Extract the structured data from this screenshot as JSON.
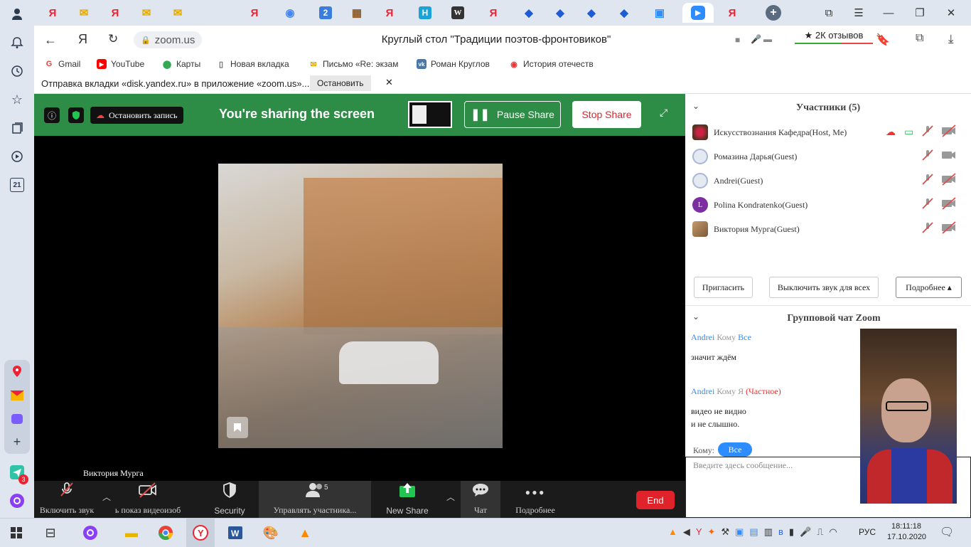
{
  "browser": {
    "url": "zoom.us",
    "page_title": "Круглый стол \"Традиции поэтов-фронтовиков\"",
    "reviews": "★ 2К отзывов",
    "yandex_letter": "Я",
    "notification": "Отправка вкладки «disk.yandex.ru» в приложение «zoom.us»...",
    "notification_stop": "Остановить",
    "bookmarks": [
      {
        "label": "Gmail",
        "icon": "gmail-icon"
      },
      {
        "label": "YouTube",
        "icon": "youtube-icon"
      },
      {
        "label": "Карты",
        "icon": "maps-icon"
      },
      {
        "label": "Новая вкладка",
        "icon": "page-icon"
      },
      {
        "label": "Письмо «Re: экзам",
        "icon": "mail-icon"
      },
      {
        "label": "Роман Круглов",
        "icon": "vk-icon"
      },
      {
        "label": "История отечеств",
        "icon": "chrome-icon"
      }
    ],
    "tabs": [
      "Я",
      "✉",
      "Я",
      "✉",
      "Я",
      "◉",
      "2",
      "▦",
      "Я",
      "Н",
      "W",
      "Я",
      "◆",
      "◆",
      "◆",
      "◆",
      "▣",
      "▶",
      "Я"
    ],
    "sidebar_badge": "21",
    "messenger_badge": "3"
  },
  "share": {
    "stop_record": "Остановить запись",
    "title": "You're sharing the screen",
    "pause": "Pause Share",
    "stop": "Stop Share"
  },
  "stage": {
    "participant_name": "Виктория Мурга"
  },
  "toolbar": {
    "unmute": "Включить звук",
    "video": "ь показ видеоизоб",
    "security": "Security",
    "participants": "Управлять участника...",
    "participants_count": "5",
    "new_share": "New Share",
    "chat": "Чат",
    "more": "Подробнее",
    "end": "End"
  },
  "participants": {
    "header": "Участники (5)",
    "list": [
      {
        "name": "Искусствознания Кафедра(Host, Me)"
      },
      {
        "name": "Ромазина Дарья(Guest)"
      },
      {
        "name": "Andrei(Guest)"
      },
      {
        "name": "Polina Kondratenko(Guest)",
        "initial": "L"
      },
      {
        "name": "Виктория Мурга(Guest)"
      }
    ],
    "invite": "Пригласить",
    "mute_all": "Выключить звук для всех",
    "more": "Подробнее ▴"
  },
  "chat": {
    "header": "Групповой чат Zoom",
    "messages": [
      {
        "from": "Andrei",
        "to_word": "Кому",
        "to": "Все",
        "private": "",
        "lines": [
          "значит ждём"
        ]
      },
      {
        "from": "Andrei",
        "to_word": "Кому",
        "to": "Я",
        "private": "(Частное)",
        "lines": [
          "видео не видно",
          "и не слышно."
        ]
      }
    ],
    "to_label": "Кому:",
    "to_value": "Все",
    "placeholder": "Введите здесь сообщение..."
  },
  "taskbar": {
    "time": "18:11:18",
    "date": "17.10.2020",
    "lang": "РУС"
  },
  "colors": {
    "share_green": "#2d8c46",
    "end_red": "#e0232a",
    "zoom_blue": "#2d8cff",
    "stop_red": "#e0232a"
  }
}
